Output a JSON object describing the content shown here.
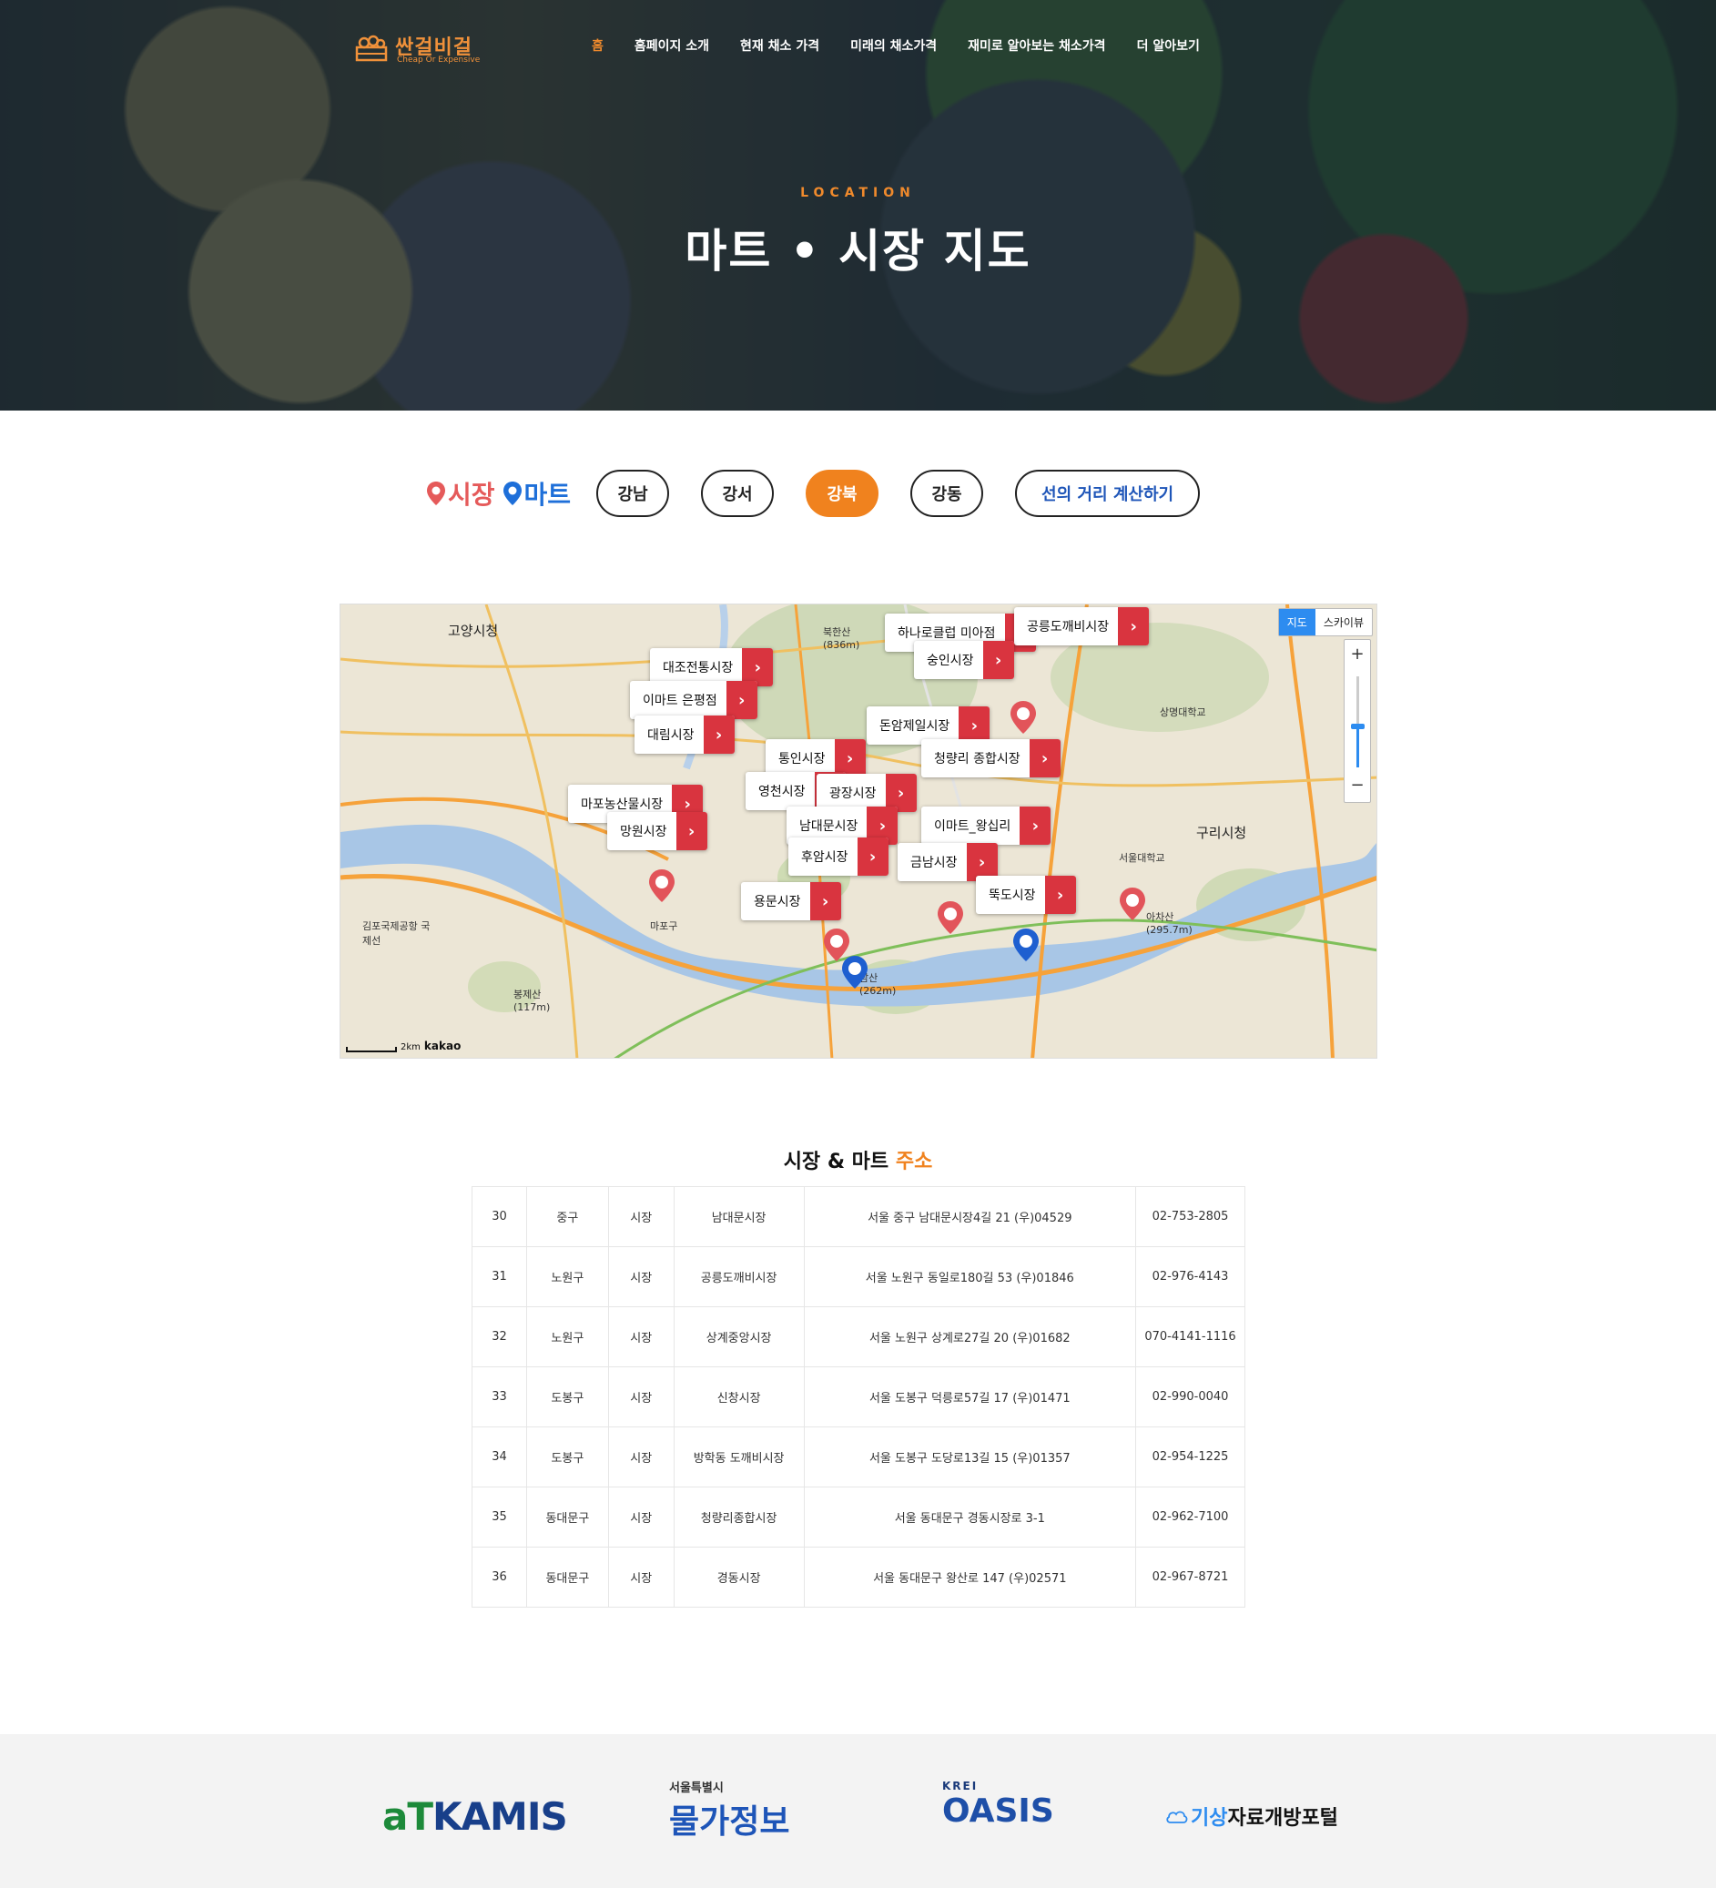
{
  "header": {
    "logo_title": "싼걸비걸",
    "logo_subtitle": "Cheap Or Expensive",
    "nav": [
      "홈",
      "홈페이지 소개",
      "현재 채소 가격",
      "미래의 채소가격",
      "재미로 알아보는 채소가격",
      "더 알아보기"
    ],
    "eyebrow": "LOCATION",
    "title": "마트 • 시장 지도"
  },
  "filters": {
    "legend_market": "시장",
    "legend_mart": "마트",
    "regions": [
      "강남",
      "강서",
      "강북",
      "강동"
    ],
    "active_region": "강북",
    "distance_button": "선의 거리 계산하기",
    "colors": {
      "market": "#e55a5a",
      "mart": "#1e6fd9",
      "accent": "#f0821e"
    }
  },
  "map": {
    "type_buttons": [
      "지도",
      "스카이뷰"
    ],
    "zoom_in": "+",
    "zoom_out": "−",
    "scale": "2km",
    "brand": "kakao",
    "area_labels": [
      "고양시청",
      "구리시청",
      "마포구",
      "아차산 (295.7m)",
      "북한산 (836m)",
      "봉제산 (117m)",
      "남산 (262m)",
      "김포국제공항 국제선",
      "서울대학교",
      "상명대학교"
    ],
    "callouts": [
      "하나로클럽 미아점",
      "공릉도깨비시장",
      "대조전통시장",
      "숭인시장",
      "이마트 은평점",
      "돈암제일시장",
      "대림시장",
      "통인시장",
      "청량리 종합시장",
      "영천시장",
      "광장시장",
      "마포농산물시장",
      "남대문시장",
      "이마트_왕십리",
      "망원시장",
      "후암시장",
      "금남시장",
      "용문시장",
      "뚝도시장"
    ]
  },
  "table": {
    "title": "시장 & 마트",
    "title_highlight": "주소",
    "rows": [
      [
        "30",
        "중구",
        "시장",
        "남대문시장",
        "서울 중구 남대문시장4길 21 (우)04529",
        "02-753-2805"
      ],
      [
        "31",
        "노원구",
        "시장",
        "공릉도깨비시장",
        "서울 노원구 동일로180길 53 (우)01846",
        "02-976-4143"
      ],
      [
        "32",
        "노원구",
        "시장",
        "상계중앙시장",
        "서울 노원구 상계로27길 20 (우)01682",
        "070-4141-1116"
      ],
      [
        "33",
        "도봉구",
        "시장",
        "신창시장",
        "서울 도봉구 덕릉로57길 17 (우)01471",
        "02-990-0040"
      ],
      [
        "34",
        "도봉구",
        "시장",
        "방학동 도깨비시장",
        "서울 도봉구 도당로13길 15 (우)01357",
        "02-954-1225"
      ],
      [
        "35",
        "동대문구",
        "시장",
        "청량리종합시장",
        "서울 동대문구 경동시장로 3-1",
        "02-962-7100"
      ],
      [
        "36",
        "동대문구",
        "시장",
        "경동시장",
        "서울 동대문구 왕산로 147 (우)02571",
        "02-967-8721"
      ]
    ]
  },
  "footer": {
    "kamis_a": "aT",
    "kamis_b": "KAMIS",
    "seoul_small": "서울특별시",
    "seoul_big": "물가정보",
    "oasis_small": "KREI",
    "oasis_big": "OASIS",
    "weather_a": "기상",
    "weather_b": "자료개방포털"
  }
}
